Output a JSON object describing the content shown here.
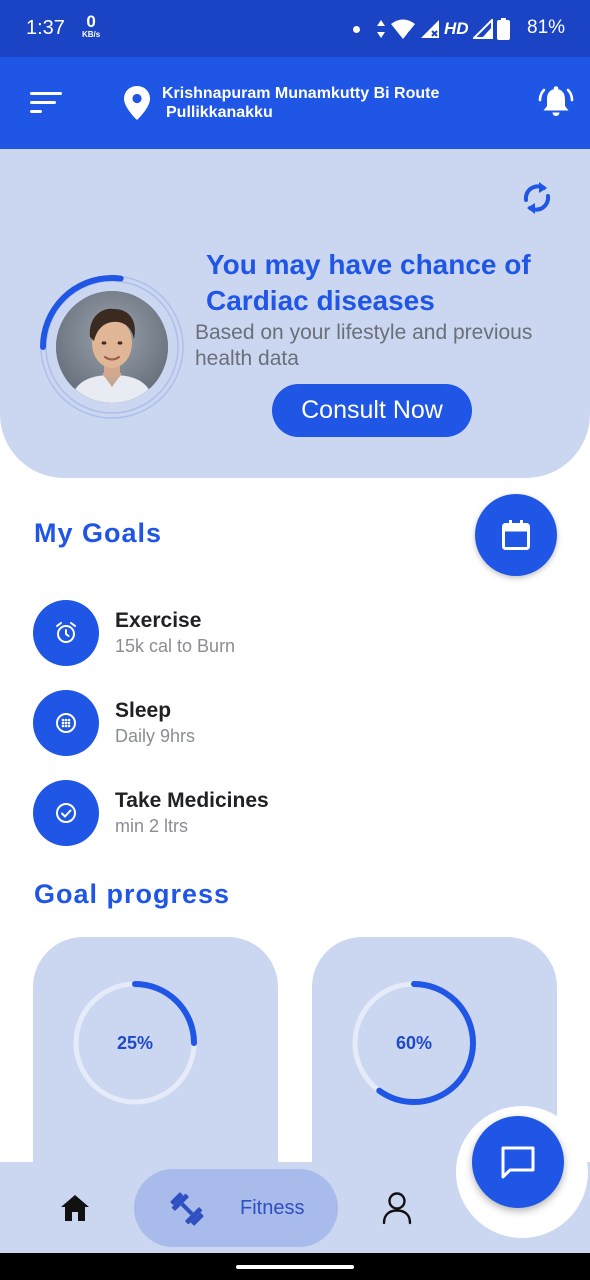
{
  "status_bar": {
    "time": "1:37",
    "net_speed_value": "0",
    "net_speed_unit": "KB/s",
    "network_label": "HD",
    "battery": "81%",
    "icons": [
      "dot-icon",
      "data-arrows-icon",
      "wifi-icon",
      "signal-icon",
      "signal-icon",
      "battery-icon"
    ]
  },
  "header": {
    "location_line1": "Krishnapuram Munamkutty Bi Route",
    "location_line2": "Pullikkanakku",
    "icons": [
      "menu-icon",
      "location-pin-icon",
      "bell-icon"
    ]
  },
  "hero": {
    "title": "You may have chance of Cardiac diseases",
    "subtitle": "Based on your lifestyle and previous health data",
    "consult_button": "Consult Now",
    "risk_ring_progress": 0.27,
    "icons": [
      "refresh-icon"
    ]
  },
  "goals": {
    "title": "My Goals",
    "items": [
      {
        "name": "Exercise",
        "desc": "15k cal to Burn",
        "icon": "alarm-clock-icon"
      },
      {
        "name": "Sleep",
        "desc": "Daily 9hrs",
        "icon": "grid-circle-icon"
      },
      {
        "name": "Take Medicines",
        "desc": "min 2 ltrs",
        "icon": "check-circle-icon"
      }
    ]
  },
  "goal_progress": {
    "title": "Goal progress",
    "cards": [
      {
        "label": "25%",
        "value": 0.25
      },
      {
        "label": "60%",
        "value": 0.6
      }
    ]
  },
  "bottom_nav": {
    "items": [
      {
        "icon": "home-icon",
        "label": ""
      },
      {
        "icon": "dumbbell-icon",
        "label": "Fitness",
        "active": true
      },
      {
        "icon": "profile-icon",
        "label": ""
      }
    ]
  },
  "colors": {
    "primary": "#1f56e6",
    "status_bar": "#1a44c4",
    "hero_bg": "#cbd6f1",
    "nav_active_bg": "#a9bbea",
    "text_dark": "#202124",
    "text_muted": "#8a8d93"
  }
}
